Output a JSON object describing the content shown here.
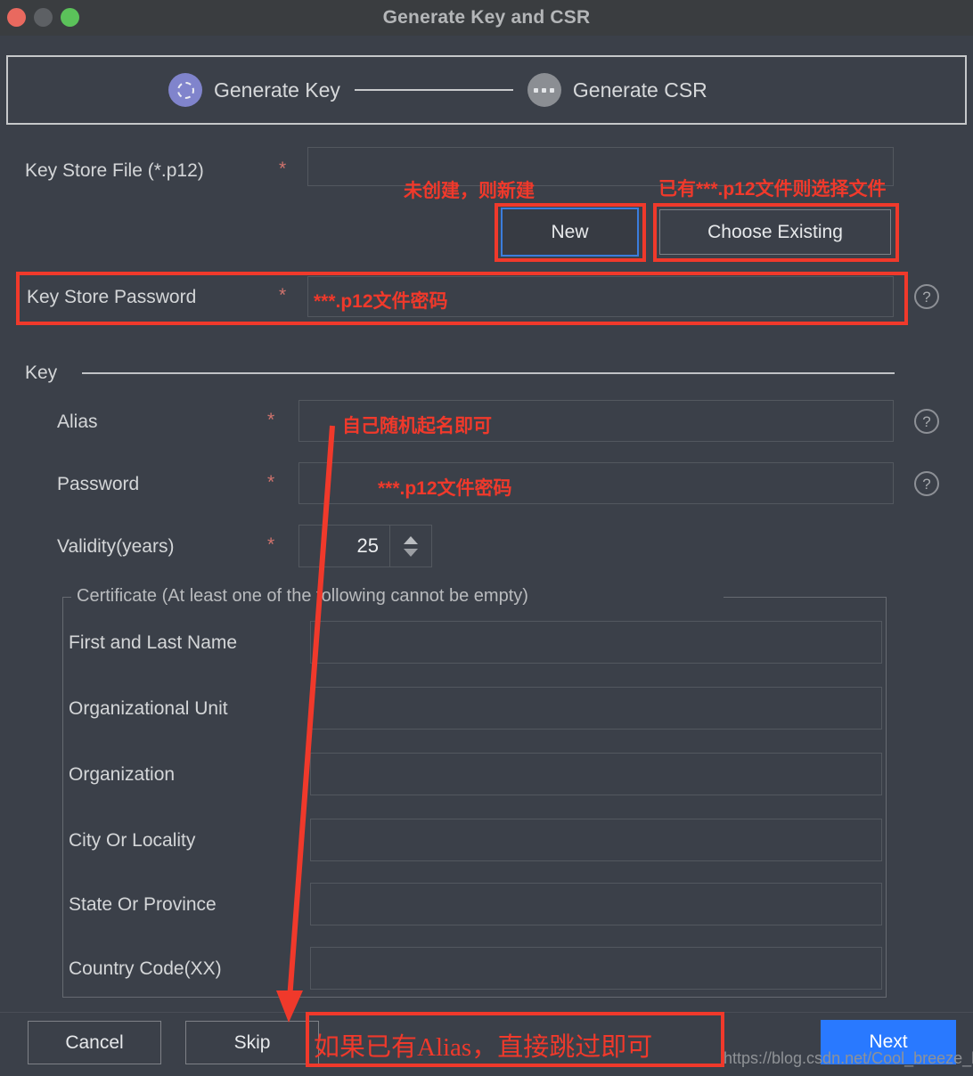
{
  "window": {
    "title": "Generate Key and CSR",
    "traffic_lights": [
      "close-button",
      "minimize-button",
      "maximize-button"
    ]
  },
  "stepper": {
    "steps": [
      {
        "label": "Generate Key",
        "state": "active",
        "icon": "dashed-circle-icon"
      },
      {
        "label": "Generate CSR",
        "state": "inactive",
        "icon": "ellipsis-icon"
      }
    ]
  },
  "form": {
    "key_store_file": {
      "label": "Key Store File (*.p12)",
      "required_marker": "*",
      "value": "",
      "new_button": "New",
      "choose_button": "Choose Existing"
    },
    "key_store_password": {
      "label": "Key Store Password",
      "required_marker": "*",
      "value": "",
      "help_icon": "?"
    },
    "key_group": {
      "title": "Key",
      "alias": {
        "label": "Alias",
        "required_marker": "*",
        "value": "",
        "help_icon": "?"
      },
      "password": {
        "label": "Password",
        "required_marker": "*",
        "value": "",
        "help_icon": "?"
      },
      "validity": {
        "label": "Validity(years)",
        "required_marker": "*",
        "value": "25"
      },
      "certificate": {
        "legend": "Certificate (At least one of the following cannot be empty)",
        "fields": [
          {
            "label": "First and Last Name",
            "value": ""
          },
          {
            "label": "Organizational Unit",
            "value": ""
          },
          {
            "label": "Organization",
            "value": ""
          },
          {
            "label": "City Or Locality",
            "value": ""
          },
          {
            "label": "State Or Province",
            "value": ""
          },
          {
            "label": "Country Code(XX)",
            "value": ""
          }
        ]
      }
    }
  },
  "footer": {
    "cancel": "Cancel",
    "skip": "Skip",
    "next": "Next"
  },
  "annotations": {
    "new_note": "未创建，则新建",
    "choose_note": "已有***.p12文件则选择文件",
    "key_store_password_note": "***.p12文件密码",
    "alias_note": "自己随机起名即可",
    "password_note": "***.p12文件密码",
    "skip_note": "如果已有Alias，直接跳过即可",
    "color": "#f0392b"
  },
  "watermark": {
    "text": "https://blog.csdn.net/Cool_breeze_bin"
  },
  "colors": {
    "background": "#3b4049",
    "titlebar": "#3a3d40",
    "accent_blue": "#2979ff",
    "focus_blue": "#3b7ddd",
    "step_active": "#8084cc",
    "step_inactive": "#8b8e93",
    "annotation_red": "#f0392b",
    "required_red": "#d0736d"
  }
}
